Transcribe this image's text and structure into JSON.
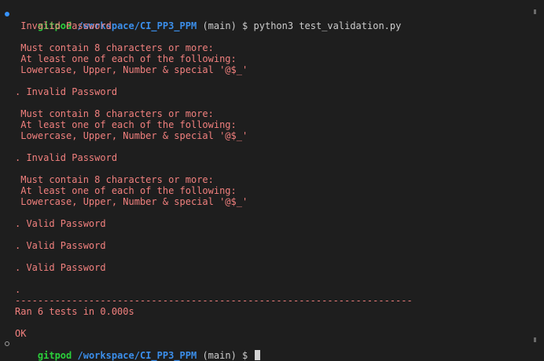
{
  "prompt": {
    "user": "gitpod",
    "path": "/workspace/CI_PP3_PPM",
    "branch": "(main)",
    "symbol": "$",
    "command": "python3 test_validation.py"
  },
  "output": {
    "l01": " Invalid Password",
    "l02": "",
    "l03": " Must contain 8 characters or more:",
    "l04": " At least one of each of the following:",
    "l05": " Lowercase, Upper, Number & special '@$_'",
    "l06": "",
    "l07": ". Invalid Password",
    "l08": "",
    "l09": " Must contain 8 characters or more:",
    "l10": " At least one of each of the following:",
    "l11": " Lowercase, Upper, Number & special '@$_'",
    "l12": "",
    "l13": ". Invalid Password",
    "l14": "",
    "l15": " Must contain 8 characters or more:",
    "l16": " At least one of each of the following:",
    "l17": " Lowercase, Upper, Number & special '@$_'",
    "l18": "",
    "l19": ". Valid Password",
    "l20": "",
    "l21": ". Valid Password",
    "l22": "",
    "l23": ". Valid Password",
    "l24": "",
    "l25": ".",
    "l26": "----------------------------------------------------------------------",
    "l27": "Ran 6 tests in 0.000s",
    "l28": "",
    "l29": "OK"
  },
  "colors": {
    "background": "#1e1e1e",
    "error_text": "#f1807e",
    "prompt_user": "#2bd13b",
    "prompt_path": "#3b8eea",
    "decoration_success": "#3794ff"
  }
}
